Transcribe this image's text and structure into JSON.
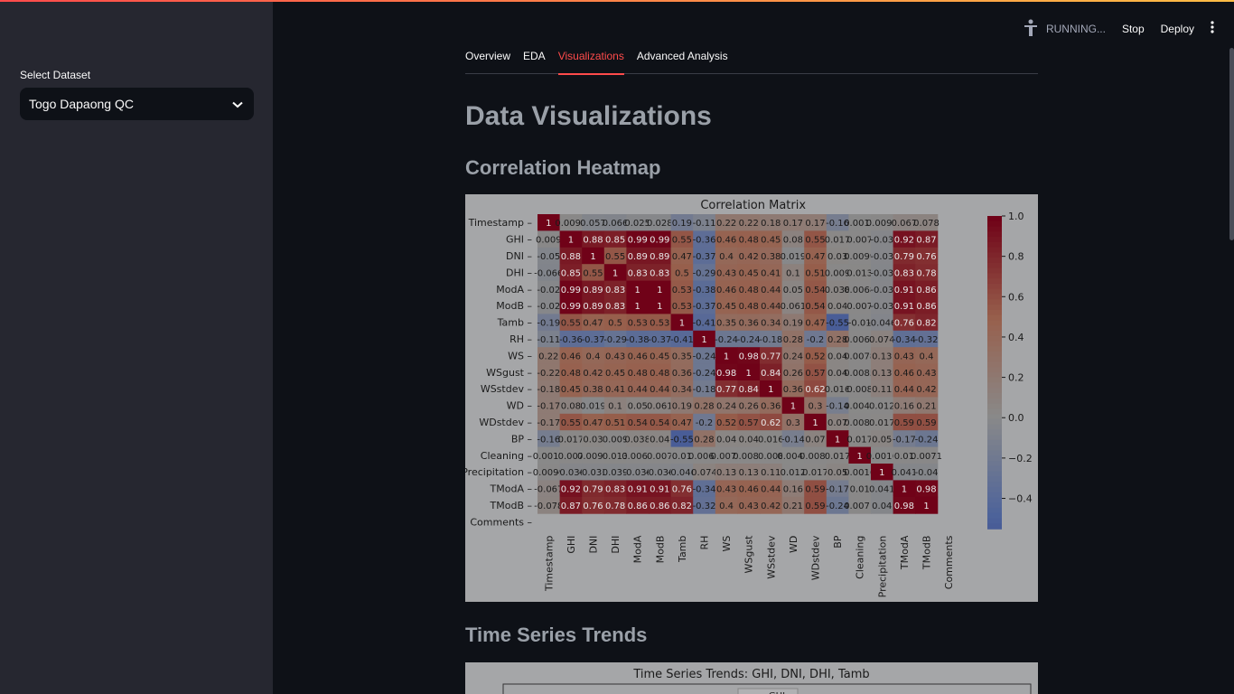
{
  "sidebar": {
    "select_label": "Select Dataset",
    "select_value": "Togo Dapaong QC"
  },
  "header": {
    "status": "RUNNING...",
    "stop_label": "Stop",
    "deploy_label": "Deploy"
  },
  "tabs": [
    {
      "label": "Overview"
    },
    {
      "label": "EDA"
    },
    {
      "label": "Visualizations",
      "active": true
    },
    {
      "label": "Advanced Analysis"
    }
  ],
  "main": {
    "title": "Data Visualizations",
    "section1": "Correlation Heatmap",
    "section2": "Time Series Trends"
  },
  "chart_data": [
    {
      "type": "heatmap",
      "title": "Correlation Matrix",
      "labels": [
        "Timestamp",
        "GHI",
        "DNI",
        "DHI",
        "ModA",
        "ModB",
        "Tamb",
        "RH",
        "WS",
        "WSgust",
        "WSstdev",
        "WD",
        "WDstdev",
        "BP",
        "Cleaning",
        "Precipitation",
        "TModA",
        "TModB",
        "Comments"
      ],
      "colorbar_ticks": [
        "1.0",
        "0.8",
        "0.6",
        "0.4",
        "0.2",
        "0.0",
        "−0.2",
        "−0.4"
      ],
      "values": [
        [
          "1",
          "0.0098",
          "-0.057",
          "-0.066",
          "-0.025",
          "-0.028",
          "-0.19",
          "-0.11",
          "0.22",
          "0.22",
          "0.18",
          "0.17",
          "0.17",
          "-0.16",
          "0.0017",
          "0.0099",
          "0.067",
          "0.078",
          ""
        ],
        [
          "0.0098",
          "1",
          "0.88",
          "0.85",
          "0.99",
          "0.99",
          "0.55",
          "-0.36",
          "0.46",
          "0.48",
          "0.45",
          "0.08",
          "0.55",
          "0.017",
          "0.007",
          "-0.036",
          "0.92",
          "0.87",
          ""
        ],
        [
          "-0.057",
          "0.88",
          "1",
          "0.55",
          "0.89",
          "0.89",
          "0.47",
          "-0.37",
          "0.4",
          "0.42",
          "0.38",
          "-0.019",
          "0.47",
          "0.03",
          "0.0099",
          "-0.033",
          "0.79",
          "0.76",
          ""
        ],
        [
          "-0.066",
          "0.85",
          "0.55",
          "1",
          "0.83",
          "0.83",
          "0.5",
          "-0.29",
          "0.43",
          "0.45",
          "0.41",
          "0.1",
          "0.51",
          "0.009",
          "0.013",
          "-0.039",
          "0.83",
          "0.78",
          ""
        ],
        [
          "-0.025",
          "0.99",
          "0.89",
          "0.83",
          "1",
          "1",
          "0.53",
          "-0.38",
          "0.46",
          "0.48",
          "0.44",
          "0.05",
          "0.54",
          "0.038",
          "0.0068",
          "-0.036",
          "0.91",
          "0.86",
          ""
        ],
        [
          "-0.028",
          "0.99",
          "0.89",
          "0.83",
          "1",
          "1",
          "0.53",
          "-0.37",
          "0.45",
          "0.48",
          "0.44",
          "0.061",
          "0.54",
          "0.04",
          "0.007",
          "-0.036",
          "0.91",
          "0.86",
          ""
        ],
        [
          "-0.19",
          "0.55",
          "0.47",
          "0.5",
          "0.53",
          "0.53",
          "1",
          "-0.41",
          "0.35",
          "0.36",
          "0.34",
          "0.19",
          "0.47",
          "-0.55",
          "-0.01",
          "-0.046",
          "0.76",
          "0.82",
          ""
        ],
        [
          "-0.11",
          "-0.36",
          "-0.37",
          "-0.29",
          "-0.38",
          "-0.37",
          "-0.41",
          "1",
          "-0.24",
          "-0.24",
          "-0.18",
          "0.28",
          "-0.22",
          "0.28",
          "0.0064",
          "0.074",
          "-0.34",
          "-0.32",
          ""
        ],
        [
          "0.22",
          "0.46",
          "0.4",
          "0.43",
          "0.46",
          "0.45",
          "0.35",
          "-0.24",
          "1",
          "0.98",
          "0.77",
          "0.24",
          "0.52",
          "0.04",
          "0.0078",
          "0.13",
          "0.43",
          "0.4",
          ""
        ],
        [
          "0.22",
          "0.48",
          "0.42",
          "0.45",
          "0.48",
          "0.48",
          "0.36",
          "-0.24",
          "0.98",
          "1",
          "0.84",
          "0.26",
          "0.57",
          "0.04",
          "0.0085",
          "0.13",
          "0.46",
          "0.43",
          ""
        ],
        [
          "0.18",
          "0.45",
          "0.38",
          "0.41",
          "0.44",
          "0.44",
          "0.34",
          "-0.18",
          "0.77",
          "0.84",
          "1",
          "0.36",
          "0.62",
          "0.016",
          "0.008",
          "0.11",
          "0.44",
          "0.42",
          ""
        ],
        [
          "0.17",
          "0.08",
          "-0.019",
          "0.1",
          "0.05",
          "0.061",
          "0.19",
          "0.28",
          "0.24",
          "0.26",
          "0.36",
          "1",
          "0.3",
          "-0.14",
          "0.0047",
          "0.012",
          "0.16",
          "0.21",
          ""
        ],
        [
          "0.17",
          "0.55",
          "0.47",
          "0.51",
          "0.54",
          "0.54",
          "0.47",
          "-0.22",
          "0.52",
          "0.57",
          "0.62",
          "0.3",
          "1",
          "0.071",
          "0.0089",
          "0.017",
          "0.59",
          "0.59",
          ""
        ],
        [
          "-0.16",
          "0.017",
          "0.03",
          "0.009",
          "0.038",
          "0.04",
          "-0.55",
          "0.28",
          "0.04",
          "0.04",
          "0.016",
          "-0.14",
          "0.071",
          "1",
          "0.017",
          "0.05",
          "-0.17",
          "-0.24",
          ""
        ],
        [
          "0.0017",
          "0.007",
          "0.0099",
          "0.013",
          "0.0068",
          "0.007",
          "-0.01",
          "0.0064",
          "0.0078",
          "0.0085",
          "0.008",
          "0.0047",
          "0.0089",
          "0.017",
          "1",
          "0.0016",
          "0.01",
          "0.0071",
          ""
        ],
        [
          "0.0099",
          "-0.036",
          "-0.033",
          "-0.039",
          "-0.036",
          "-0.036",
          "-0.046",
          "0.074",
          "0.13",
          "0.13",
          "0.11",
          "0.012",
          "0.017",
          "0.05",
          "0.0016",
          "1",
          "-0.041",
          "-0.04",
          ""
        ],
        [
          "0.067",
          "0.92",
          "0.79",
          "0.83",
          "0.91",
          "0.91",
          "0.76",
          "-0.34",
          "0.43",
          "0.46",
          "0.44",
          "0.16",
          "0.59",
          "-0.17",
          "0.01",
          "-0.041",
          "1",
          "0.98",
          ""
        ],
        [
          "0.078",
          "0.87",
          "0.76",
          "0.78",
          "0.86",
          "0.86",
          "0.82",
          "-0.32",
          "0.4",
          "0.43",
          "0.42",
          "0.21",
          "0.59",
          "-0.24",
          "0.0071",
          "-0.04",
          "0.98",
          "1",
          ""
        ],
        [
          "",
          "",
          "",
          "",
          "",
          "",
          "",
          "",
          "",
          "",
          "",
          "",
          "",
          "",
          "",
          "",
          "",
          "",
          ""
        ]
      ],
      "value_labels": [
        [
          "1",
          "0.0098",
          "0.057",
          "0.066",
          "0.025",
          "0.028",
          "0.19",
          "-0.11",
          "0.22",
          "0.22",
          "0.18",
          "0.17",
          "0.17",
          "-0.16",
          "0.0017",
          "0.0099",
          "0.067",
          "0.078",
          ""
        ],
        [
          "0.009",
          "1",
          "0.88",
          "0.85",
          "0.99",
          "0.99",
          "0.55",
          "-0.36",
          "0.46",
          "0.48",
          "0.45",
          "0.08",
          "0.55",
          "0.017",
          "0.007",
          "-0.03",
          "0.92",
          "0.87",
          ""
        ],
        [
          "-0.05",
          "0.88",
          "1",
          "0.55",
          "0.89",
          "0.89",
          "0.47",
          "-0.37",
          "0.4",
          "0.42",
          "0.38",
          "0.019",
          "0.47",
          "0.03",
          "0.0099",
          "-0.03",
          "0.79",
          "0.76",
          ""
        ],
        [
          "-0.066",
          "0.85",
          "0.55",
          "1",
          "0.83",
          "0.83",
          "0.5",
          "-0.29",
          "0.43",
          "0.45",
          "0.41",
          "0.1",
          "0.51",
          "0.009",
          "0.013",
          "-0.03",
          "0.83",
          "0.78",
          ""
        ],
        [
          "-0.02",
          "0.99",
          "0.89",
          "0.83",
          "1",
          "1",
          "0.53",
          "-0.38",
          "0.46",
          "0.48",
          "0.44",
          "0.05",
          "0.54",
          "0.038",
          "0.0068",
          "-0.03",
          "0.91",
          "0.86",
          ""
        ],
        [
          "-0.02",
          "0.99",
          "0.89",
          "0.83",
          "1",
          "1",
          "0.53",
          "-0.37",
          "0.45",
          "0.48",
          "0.44",
          "0.061",
          "0.54",
          "0.04",
          "0.007",
          "-0.03",
          "0.91",
          "0.86",
          ""
        ],
        [
          "-0.19",
          "0.55",
          "0.47",
          "0.5",
          "0.53",
          "0.53",
          "1",
          "-0.41",
          "0.35",
          "0.36",
          "0.34",
          "0.19",
          "0.47",
          "-0.55",
          "-0.01",
          "-0.046",
          "0.76",
          "0.82",
          ""
        ],
        [
          "-0.11",
          "-0.36",
          "-0.37",
          "-0.29",
          "-0.38",
          "-0.37",
          "-0.41",
          "1",
          "-0.24",
          "-0.24",
          "-0.18",
          "0.28",
          "-0.2",
          "0.28",
          "0.0068",
          "0.074",
          "-0.34",
          "-0.32",
          ""
        ],
        [
          "0.22",
          "0.46",
          "0.4",
          "0.43",
          "0.46",
          "0.45",
          "0.35",
          "-0.24",
          "1",
          "0.98",
          "0.77",
          "0.24",
          "0.52",
          "0.04",
          "0.0078",
          "0.13",
          "0.43",
          "0.4",
          ""
        ],
        [
          "-0.22",
          "0.48",
          "0.42",
          "0.45",
          "0.48",
          "0.48",
          "0.36",
          "-0.24",
          "0.98",
          "1",
          "0.84",
          "0.26",
          "0.57",
          "0.04",
          "0.0085",
          "0.13",
          "0.46",
          "0.43",
          ""
        ],
        [
          "-0.18",
          "0.45",
          "0.38",
          "0.41",
          "0.44",
          "0.44",
          "0.34",
          "-0.18",
          "0.77",
          "0.84",
          "1",
          "0.36",
          "0.62",
          "0.016",
          "0.008",
          "0.11",
          "0.44",
          "0.42",
          ""
        ],
        [
          "-0.17",
          "0.08",
          "0.019",
          "0.1",
          "0.05",
          "0.061",
          "0.19",
          "0.28",
          "0.24",
          "0.26",
          "0.36",
          "1",
          "0.3",
          "-0.14",
          "0.0047",
          "0.012",
          "0.16",
          "0.21",
          ""
        ],
        [
          "-0.17",
          "0.55",
          "0.47",
          "0.51",
          "0.54",
          "0.54",
          "0.47",
          "-0.2",
          "0.52",
          "0.57",
          "0.62",
          "0.3",
          "1",
          "0.07",
          "0.0089",
          "0.017",
          "0.59",
          "0.59",
          ""
        ],
        [
          "-0.16",
          "0.017",
          "0.03",
          "0.009",
          "0.038",
          "0.04",
          "-0.55",
          "0.28",
          "0.04",
          "0.04",
          "0.016",
          "-0.14",
          "0.07",
          "1",
          "0.017",
          "0.05",
          "-0.17",
          "-0.24",
          ""
        ],
        [
          "0.0017",
          "0.007",
          "0.0099",
          "0.013",
          "0.0068",
          "0.007",
          "0.01",
          "0.0064",
          "0.0078",
          "0.0085",
          "0.008",
          "0.0047",
          "0.0089",
          "0.017",
          "1",
          "0.0016",
          "0.01",
          "0.0071",
          ""
        ],
        [
          "0.0099",
          "-0.036",
          "-0.033",
          "0.039",
          "-0.036",
          "-0.036",
          "-0.046",
          "0.074",
          "0.13",
          "0.13",
          "0.11",
          "0.012",
          "0.017",
          "0.05",
          "0.0016",
          "1",
          "0.041",
          "-0.04",
          ""
        ],
        [
          "-0.067",
          "0.92",
          "0.79",
          "0.83",
          "0.91",
          "0.91",
          "0.76",
          "-0.34",
          "0.43",
          "0.46",
          "0.44",
          "0.16",
          "0.59",
          "-0.17",
          "0.01",
          "0.041",
          "1",
          "0.98",
          ""
        ],
        [
          "-0.078",
          "0.87",
          "0.76",
          "0.78",
          "0.86",
          "0.86",
          "0.82",
          "-0.32",
          "0.4",
          "0.43",
          "0.42",
          "0.21",
          "0.59",
          "-0.24",
          "0.0071",
          "0.04",
          "0.98",
          "1",
          ""
        ],
        [
          "",
          "",
          "",
          "",
          "",
          "",
          "",
          "",
          "",
          "",
          "",
          "",
          "",
          "",
          "",
          "",
          "",
          "",
          ""
        ]
      ],
      "vmin": -0.55,
      "vmax": 1.0,
      "colormap": "coolwarm"
    },
    {
      "type": "line",
      "title": "Time Series Trends: GHI, DNI, DHI, Tamb",
      "legend_visible": "GHI"
    }
  ]
}
